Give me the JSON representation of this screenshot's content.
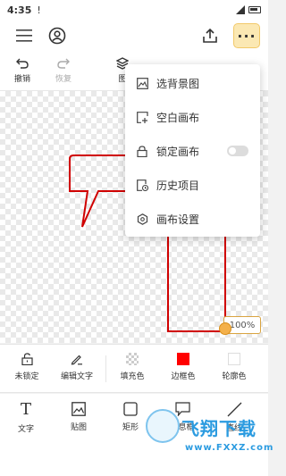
{
  "status_bar": {
    "time": "4:35",
    "warning": "!"
  },
  "toolbar": {
    "undo_label": "撤销",
    "redo_label": "恢复",
    "layers_label": "图"
  },
  "menu": {
    "items": [
      {
        "label": "选背景图",
        "icon": "image-icon"
      },
      {
        "label": "空白画布",
        "icon": "blank-canvas-icon"
      },
      {
        "label": "锁定画布",
        "icon": "lock-icon",
        "toggle_on": false
      },
      {
        "label": "历史项目",
        "icon": "history-icon"
      },
      {
        "label": "画布设置",
        "icon": "settings-icon"
      }
    ]
  },
  "canvas": {
    "zoom": "100%",
    "shape_stroke": "#d00000"
  },
  "props": {
    "lock_label": "未锁定",
    "edit_text_label": "编辑文字",
    "fill_label": "填充色",
    "border_label": "边框色",
    "outline_label": "轮廓色",
    "border_color": "#ff0000",
    "outline_color": "#ffffff"
  },
  "bottom": {
    "text_label": "文字",
    "sticker_label": "贴图",
    "rect_label": "矩形",
    "bubble_label": "消息框",
    "line_label": "直线"
  },
  "watermark": {
    "title": "飞翔下载",
    "url": "www.FXXZ.com"
  },
  "colors": {
    "accent": "#f2c96a",
    "accent_bg": "#fbe8b3"
  }
}
